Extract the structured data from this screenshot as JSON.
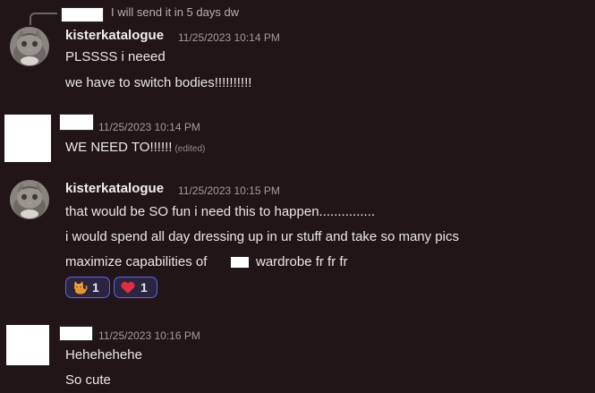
{
  "reply": {
    "text": "I will send it in 5 days dw"
  },
  "messages": [
    {
      "username": "kisterkatalogue",
      "timestamp": "11/25/2023 10:14 PM",
      "lines": [
        "PLSSSS i neeed",
        "we have to switch bodies!!!!!!!!!!"
      ]
    },
    {
      "username": "",
      "timestamp": "11/25/2023 10:14 PM",
      "lines": [
        "WE NEED TO!!!!!!"
      ],
      "edited_label": "(edited)"
    },
    {
      "username": "kisterkatalogue",
      "timestamp": "11/25/2023 10:15 PM",
      "lines": [
        "that would be SO fun i need this to happen...............",
        "i would spend all day dressing up in ur stuff and take so many pics",
        "maximize capabilities of",
        "wardrobe fr fr fr"
      ],
      "reactions": [
        {
          "emoji": "cat-emoji",
          "count": "1"
        },
        {
          "emoji": "heart-emoji",
          "count": "1"
        }
      ]
    },
    {
      "username": "",
      "timestamp": "11/25/2023 10:16 PM",
      "lines": [
        "Hehehehehe",
        "So cute"
      ]
    }
  ],
  "colors": {
    "background": "#211517",
    "reaction_border": "#5865f2",
    "reaction_bg": "#2c2540"
  }
}
